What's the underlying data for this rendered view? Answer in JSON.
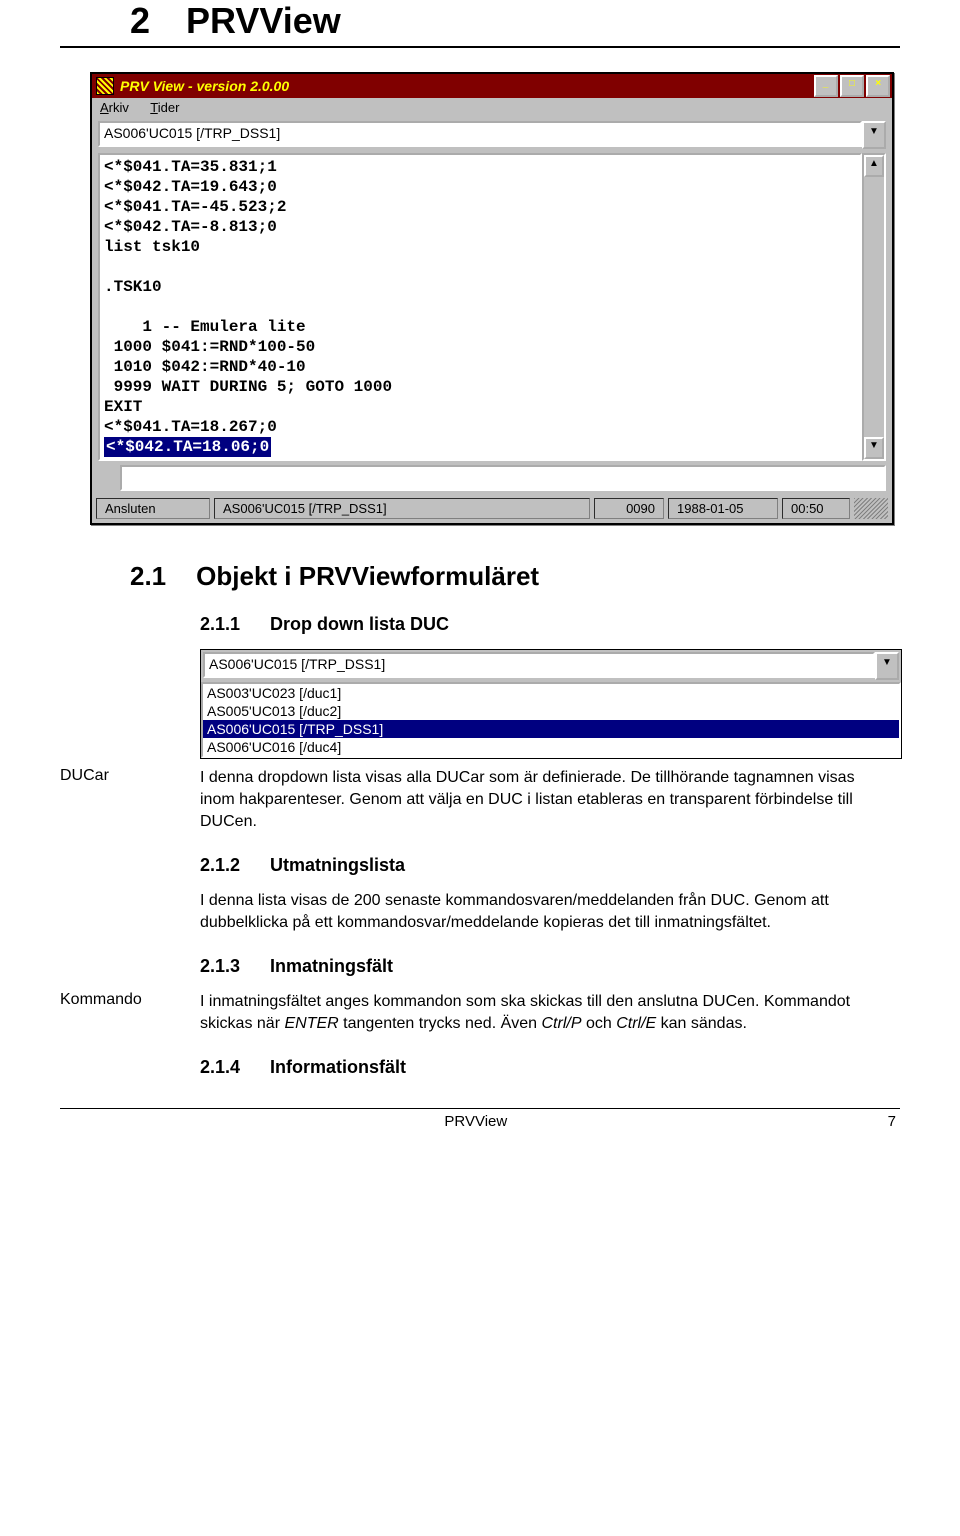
{
  "chapter": {
    "num": "2",
    "title": "PRVView"
  },
  "win1": {
    "title": "PRV View - version 2.0.00",
    "menu": {
      "arkiv": "Arkiv",
      "tider": "Tider"
    },
    "dropdown_value": "AS006'UC015 [/TRP_DSS1]",
    "terminal_lines": [
      "<*$041.TA=35.831;1",
      "<*$042.TA=19.643;0",
      "<*$041.TA=-45.523;2",
      "<*$042.TA=-8.813;0",
      "list tsk10",
      "",
      ".TSK10",
      "",
      "    1 -- Emulera lite",
      " 1000 $041:=RND*100-50",
      " 1010 $042:=RND*40-10",
      " 9999 WAIT DURING 5; GOTO 1000",
      "EXIT",
      "<*$041.TA=18.267;0"
    ],
    "terminal_selected": "<*$042.TA=18.06;0",
    "input_value": "",
    "status": {
      "conn": "Ansluten",
      "path": "AS006'UC015 [/TRP_DSS1]",
      "num": "0090",
      "date": "1988-01-05",
      "time": "00:50"
    }
  },
  "section": {
    "num": "2.1",
    "title": "Objekt i PRVViewformuläret"
  },
  "sub1": {
    "num": "2.1.1",
    "title": "Drop down lista DUC"
  },
  "win2": {
    "selected": "AS006'UC015 [/TRP_DSS1]",
    "items": [
      "AS003'UC023 [/duc1]",
      "AS005'UC013 [/duc2]",
      "AS006'UC015 [/TRP_DSS1]",
      "AS006'UC016 [/duc4]"
    ],
    "sel_index": 2
  },
  "ducar_label": "DUCar",
  "ducar_text": "I denna dropdown lista visas alla DUCar som är definierade. De tillhörande tagnamnen visas inom hakparenteser. Genom att välja en DUC i listan etableras en transparent förbindelse till DUCen.",
  "sub2": {
    "num": "2.1.2",
    "title": "Utmatningslista"
  },
  "utmat_text": "I denna lista visas de 200 senaste kommandosvaren/meddelanden från DUC. Genom att dubbelklicka på ett kommandosvar/meddelande kopieras det till inmatningsfältet.",
  "sub3": {
    "num": "2.1.3",
    "title": "Inmatningsfält"
  },
  "kommando_label": "Kommando",
  "kommando_text": "I inmatningsfältet anges kommandon som ska skickas till den anslutna DUCen. Kommandot skickas när ",
  "kommando_enter": "ENTER",
  "kommando_text2": " tangenten trycks ned. Även ",
  "kommando_ctrlp": "Ctrl/P",
  "kommando_text3": " och ",
  "kommando_ctrle": "Ctrl/E",
  "kommando_text4": " kan sändas.",
  "sub4": {
    "num": "2.1.4",
    "title": "Informationsfält"
  },
  "footer": {
    "center": "PRVView",
    "page": "7"
  }
}
